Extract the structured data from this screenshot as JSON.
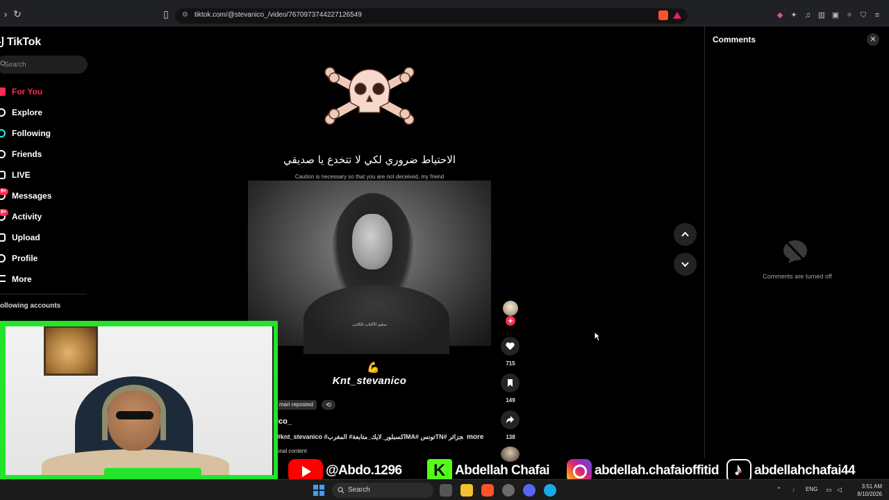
{
  "browser": {
    "url": "tiktok.com/@stevanico_/video/7670973744227126549"
  },
  "sidebar": {
    "logo": "TikTok",
    "search_placeholder": "Search",
    "items": [
      {
        "label": "For You",
        "active": true
      },
      {
        "label": "Explore"
      },
      {
        "label": "Following"
      },
      {
        "label": "Friends"
      },
      {
        "label": "LIVE"
      },
      {
        "label": "Messages",
        "badge": "9+"
      },
      {
        "label": "Activity",
        "badge": "9+"
      },
      {
        "label": "Upload"
      },
      {
        "label": "Profile"
      },
      {
        "label": "More"
      }
    ],
    "section_header": "ollowing accounts"
  },
  "video": {
    "arabic_caption": "الاحتياط ضروري لكي لا تتخدع يا صديقي",
    "english_caption": "Caution is necessary so that you are not deceived, my friend",
    "watermark": "سليم الأكتاب الكاتب",
    "emoji": "💪",
    "username_overlay": "Knt_stevanico"
  },
  "actions": {
    "likes": "715",
    "bookmarks": "149",
    "shares": "138"
  },
  "post": {
    "repost_label": "mari reposted",
    "author_handle": "ico_",
    "hashtags": "#knt_stevanico #اكسبلور_لايك_متابعة# المغربMA# تونسTN# الجزائر",
    "more_label": "more",
    "promo_label": "onal content"
  },
  "comments": {
    "title": "Comments",
    "close_symbol": "✕",
    "empty_message": "Comments are turned off"
  },
  "social_banner": [
    {
      "platform": "youtube",
      "handle": "@Abdo.1296"
    },
    {
      "platform": "kick",
      "handle": "Abdellah Chafai"
    },
    {
      "platform": "instagram",
      "handle": "abdellah.chafaioffitid"
    },
    {
      "platform": "tiktok",
      "handle": "abdellahchafai44"
    }
  ],
  "taskbar": {
    "search_label": "Search",
    "language": "ENG",
    "time": "3:51 AM",
    "date": "8/10/2026"
  },
  "colors": {
    "tiktok_accent": "#fe2c55",
    "webcam_frame": "#22e52a"
  }
}
